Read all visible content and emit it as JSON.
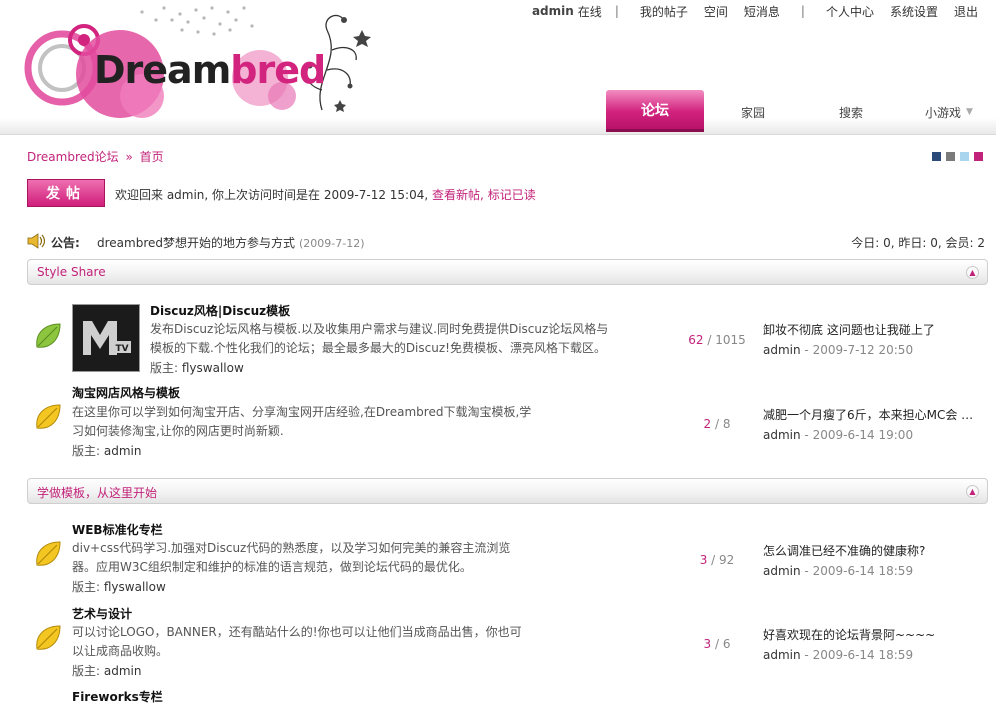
{
  "brand": {
    "logo_text_a": "Dream",
    "logo_text_b": "bred",
    "accent": "#d2237e"
  },
  "topbar": {
    "user": "admin",
    "status": "在线",
    "links": [
      "我的帖子",
      "空间",
      "短消息",
      "个人中心",
      "系统设置",
      "退出"
    ]
  },
  "nav": {
    "tabs": [
      {
        "label": "论坛",
        "active": true
      },
      {
        "label": "家园",
        "active": false
      },
      {
        "label": "搜索",
        "active": false
      },
      {
        "label": "小游戏",
        "active": false
      }
    ]
  },
  "breadcrumb": {
    "root": "Dreambred论坛",
    "sep": "»",
    "current": "首页"
  },
  "swatches": [
    "#2b4a7a",
    "#7a7a7a",
    "#a9d5ee",
    "#c2237a"
  ],
  "post": {
    "button_label": "发帖",
    "welcome_text": "欢迎回来 admin, 你上次访问时间是在 2009-7-12 15:04,",
    "link_new": "查看新帖",
    "link_sep": ",",
    "link_read": "标记已读"
  },
  "notice": {
    "label": "公告:",
    "message": "dreambred梦想开始的地方参与方式",
    "date": "(2009-7-12)",
    "stats": "今日: 0, 昨日: 0, 会员: 2"
  },
  "categories": [
    {
      "title": "Style Share",
      "toggle_icon": "collapse-icon",
      "forums": [
        {
          "name": "Discuz风格|Discuz模板",
          "has_thumb": true,
          "desc": "发布Discuz论坛风格与模板.以及收集用户需求与建议.同时免费提供Discuz论坛风格与模板的下载.个性化我们的论坛；最全最多最大的Discuz!免费模板、漂亮风格下载区。",
          "mod_label": "版主:",
          "moderator": "flyswallow",
          "topics": "62",
          "count_sep": " / ",
          "posts": "1015",
          "last_title": "卸妆不彻底 这问题也让我碰上了",
          "last_user": "admin",
          "last_dash": " - ",
          "last_time": "2009-7-12 20:50",
          "leaf_color": "green"
        },
        {
          "name": "淘宝网店风格与模板",
          "has_thumb": false,
          "desc": "在这里你可以学到如何淘宝开店、分享淘宝网开店经验,在Dreambred下载淘宝模板,学习如何装修淘宝,让你的网店更时尚新颖.",
          "mod_label": "版主:",
          "moderator": "admin",
          "topics": "2",
          "count_sep": " / ",
          "posts": "8",
          "last_title": "减肥一个月瘦了6斤，本来担心MC会 …",
          "last_user": "admin",
          "last_dash": " - ",
          "last_time": "2009-6-14 19:00",
          "leaf_color": "yellow"
        }
      ]
    },
    {
      "title": "学做模板，从这里开始",
      "toggle_icon": "collapse-icon",
      "forums": [
        {
          "name": "WEB标准化专栏",
          "has_thumb": false,
          "desc": "div+css代码学习.加强对Discuz代码的熟悉度，以及学习如何完美的兼容主流浏览器。应用W3C组织制定和维护的标准的语言规范，做到论坛代码的最优化。",
          "mod_label": "版主:",
          "moderator": "flyswallow",
          "topics": "3",
          "count_sep": " / ",
          "posts": "92",
          "last_title": "怎么调准已经不准确的健康称?",
          "last_user": "admin",
          "last_dash": " - ",
          "last_time": "2009-6-14 18:59",
          "leaf_color": "yellow"
        },
        {
          "name": "艺术与设计",
          "has_thumb": false,
          "desc": "可以讨论LOGO，BANNER，还有酷站什么的!你也可以让他们当成商品出售，你也可以让成商品收购。",
          "mod_label": "版主:",
          "moderator": "admin",
          "topics": "3",
          "count_sep": " / ",
          "posts": "6",
          "last_title": "好喜欢现在的论坛背景阿~~~~",
          "last_user": "admin",
          "last_dash": " - ",
          "last_time": "2009-6-14 18:59",
          "leaf_color": "yellow"
        },
        {
          "name": "Fireworks专栏",
          "partial": true
        }
      ]
    }
  ]
}
